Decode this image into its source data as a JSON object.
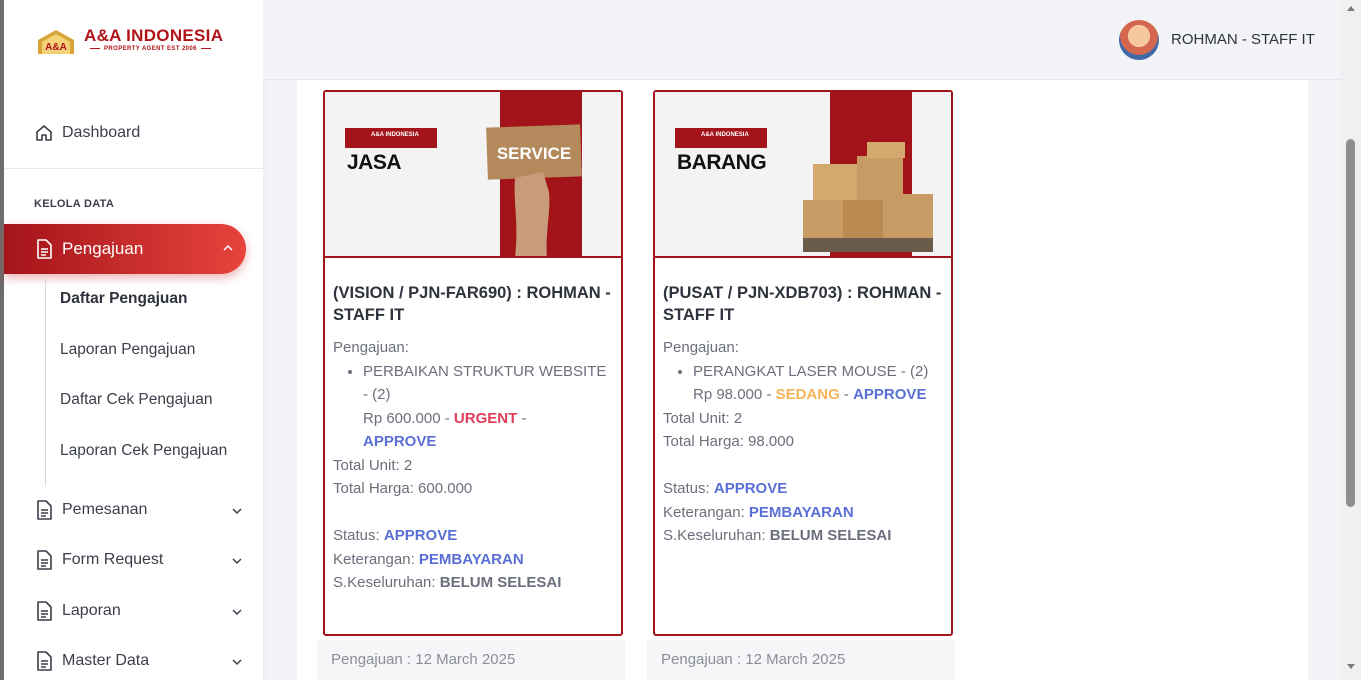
{
  "brand": {
    "name": "A&A INDONESIA",
    "tagline": "PROPERTY AGENT EST 2006",
    "badge": "A&A",
    "colors": {
      "primary": "#b01217",
      "gold": "#d9a437"
    }
  },
  "sidebar": {
    "dashboard": {
      "label": "Dashboard",
      "icon": "home-icon"
    },
    "section_label": "KELOLA DATA",
    "active": {
      "label": "Pengajuan",
      "icon": "document-icon"
    },
    "sub_items": [
      "Daftar Pengajuan",
      "Laporan Pengajuan",
      "Daftar Cek Pengajuan",
      "Laporan Cek Pengajuan"
    ],
    "items": [
      {
        "label": "Pemesanan",
        "icon": "document-icon"
      },
      {
        "label": "Form Request",
        "icon": "document-icon"
      },
      {
        "label": "Laporan",
        "icon": "document-icon"
      },
      {
        "label": "Master Data",
        "icon": "document-icon"
      }
    ]
  },
  "header": {
    "user": "ROHMAN - STAFF IT"
  },
  "cards": [
    {
      "image_label": "JASA",
      "image_sign": "SERVICE",
      "logo_text": "A&A INDONESIA",
      "title": "(VISION / PJN-FAR690) : ROHMAN - STAFF IT",
      "pengajuan_label": "Pengajuan:",
      "item": "PERBAIKAN STRUKTUR WEBSITE - (2)",
      "price": "Rp 600.000 - ",
      "priority": "URGENT",
      "sep": " - ",
      "item_status": "APPROVE",
      "total_unit": "Total Unit: 2",
      "total_harga": "Total Harga: 600.000",
      "status_label": "Status: ",
      "status": "APPROVE",
      "keterangan_label": "Keterangan: ",
      "keterangan": "PEMBAYARAN",
      "keseluruhan_label": "S.Keseluruhan: ",
      "keseluruhan": "BELUM SELESAI",
      "footer": "Pengajuan : 12 March 2025"
    },
    {
      "image_label": "BARANG",
      "logo_text": "A&A INDONESIA",
      "title": "(PUSAT / PJN-XDB703) : ROHMAN - STAFF IT",
      "pengajuan_label": "Pengajuan:",
      "item": "PERANGKAT LASER MOUSE - (2)",
      "price": "Rp 98.000 - ",
      "priority": "SEDANG",
      "sep": " - ",
      "item_status": "APPROVE",
      "total_unit": "Total Unit: 2",
      "total_harga": "Total Harga: 98.000",
      "status_label": "Status: ",
      "status": "APPROVE",
      "keterangan_label": "Keterangan: ",
      "keterangan": "PEMBAYARAN",
      "keseluruhan_label": "S.Keseluruhan: ",
      "keseluruhan": "BELUM SELESAI",
      "footer": "Pengajuan : 12 March 2025"
    }
  ],
  "colors": {
    "accent": "#a3141a",
    "approve": "#5a6fd6",
    "urgent": "#e03e5a",
    "sedang": "#f6b45a"
  }
}
